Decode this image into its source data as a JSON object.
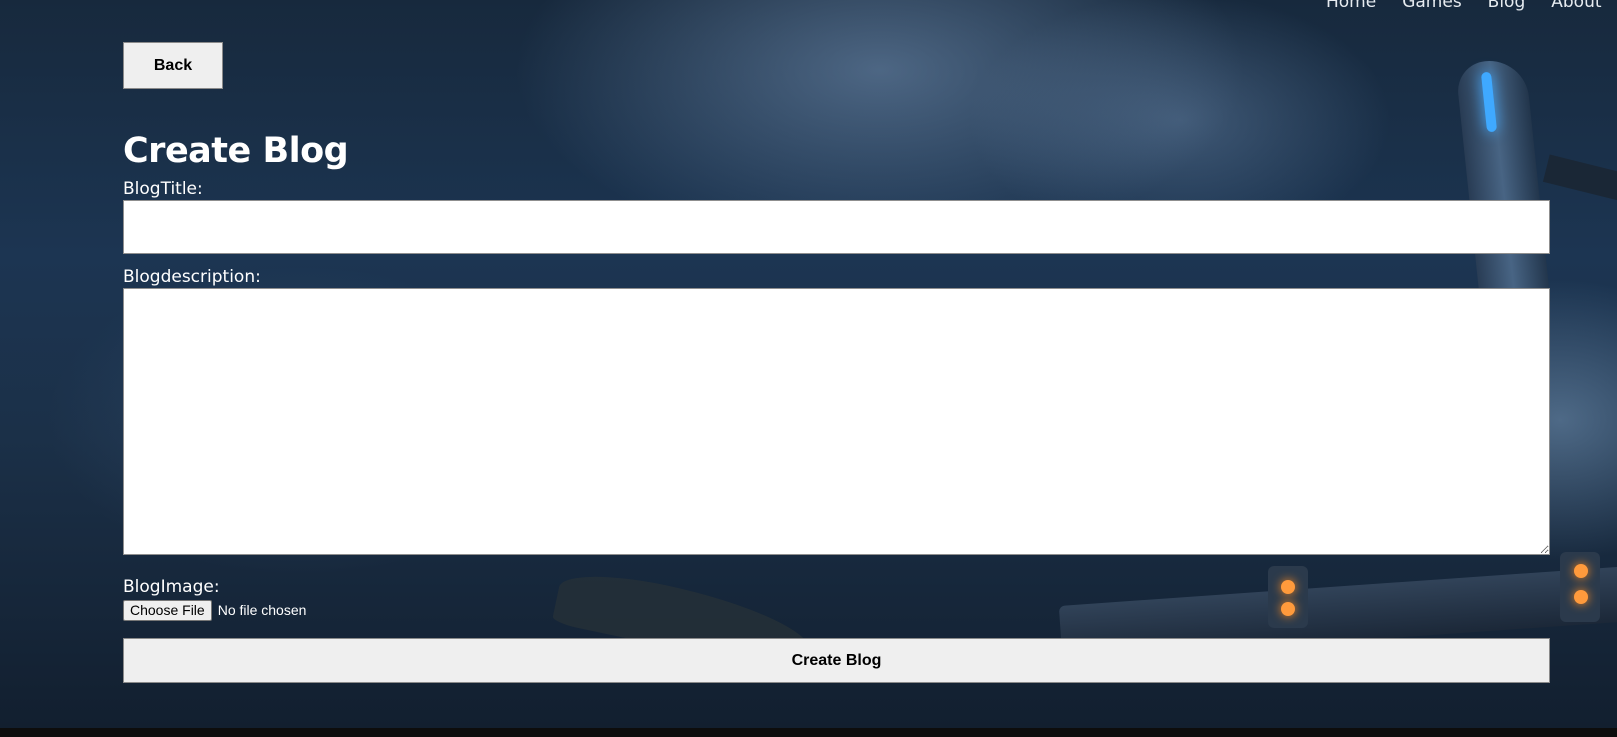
{
  "nav": {
    "items": [
      "Home",
      "Games",
      "Blog",
      "About"
    ]
  },
  "back_button_label": "Back",
  "page_title": "Create Blog",
  "form": {
    "title_label": "BlogTitle:",
    "title_value": "",
    "description_label": "Blogdescription:",
    "description_value": "",
    "image_label": "BlogImage:",
    "choose_file_label": "Choose File",
    "file_status": "No file chosen",
    "submit_label": "Create Blog"
  },
  "colors": {
    "text": "#ffffff",
    "button_bg": "#efefef",
    "input_bg": "#ffffff"
  }
}
